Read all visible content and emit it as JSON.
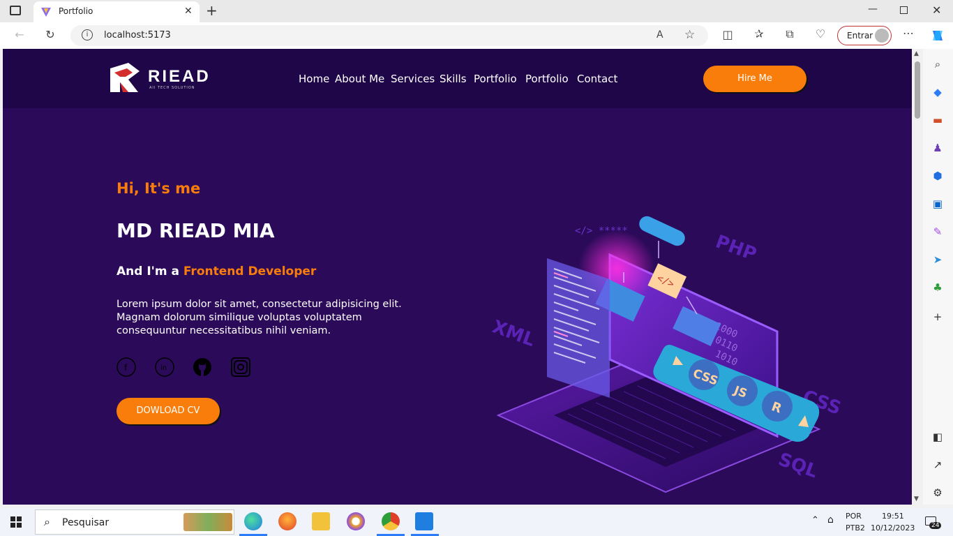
{
  "browser": {
    "tab_title": "Portfolio",
    "address": "localhost:5173",
    "signin_label": "Entrar"
  },
  "nav": {
    "logo_text": "RIEAD",
    "logo_sub": "AII TECH SOLUTION",
    "items": [
      "Home",
      "About Me",
      "Services",
      "Skills",
      "Portfolio",
      "Portfolio",
      "Contact"
    ],
    "hire_label": "Hire Me"
  },
  "hero": {
    "greeting": "Hi, It's me",
    "name": "MD RIEAD MIA",
    "role_prefix": "And I'm a",
    "role_highlight": "Frontend Developer",
    "description": "Lorem ipsum dolor sit amet, consectetur adipisicing elit. Magnam dolorum similique voluptas voluptatem consequuntur necessitatibus nihil veniam.",
    "socials": [
      "facebook-icon",
      "linkedin-icon",
      "github-icon",
      "instagram-icon"
    ],
    "cv_label": "DOWLOAD CV",
    "illustration_words": [
      "PHP",
      "XML",
      "CSS",
      "SQL",
      "CSS",
      "JS",
      "R"
    ]
  },
  "colors": {
    "accent": "#f97d0b",
    "nav_bg": "#1f0648",
    "hero_bg": "#2c0a5a"
  },
  "taskbar": {
    "search_placeholder": "Pesquisar",
    "lang": "POR",
    "layout": "PTB2",
    "time": "19:51",
    "date": "10/12/2023",
    "notifications": "24"
  }
}
